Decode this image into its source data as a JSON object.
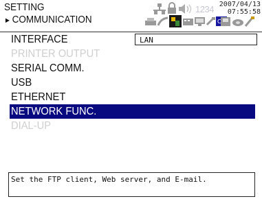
{
  "header": {
    "title": "SETTING",
    "subtitle": "COMMUNICATION",
    "arrow": "►",
    "status_number": "1234",
    "date": "2007/04/13",
    "time": "07:55:58"
  },
  "menu": {
    "interface": {
      "label": "INTERFACE",
      "value": "LAN"
    },
    "printer_output": {
      "label": "PRINTER OUTPUT"
    },
    "serial_comm": {
      "label": "SERIAL COMM."
    },
    "usb": {
      "label": "USB"
    },
    "ethernet": {
      "label": "ETHERNET"
    },
    "network_func": {
      "label": "NETWORK FUNC."
    },
    "dial_up": {
      "label": "DIAL-UP"
    }
  },
  "description": "Set the FTP client, Web server, and E-mail.",
  "colors": {
    "selected_bg": "#0a0a80",
    "disabled_text": "#cfcfcf"
  }
}
